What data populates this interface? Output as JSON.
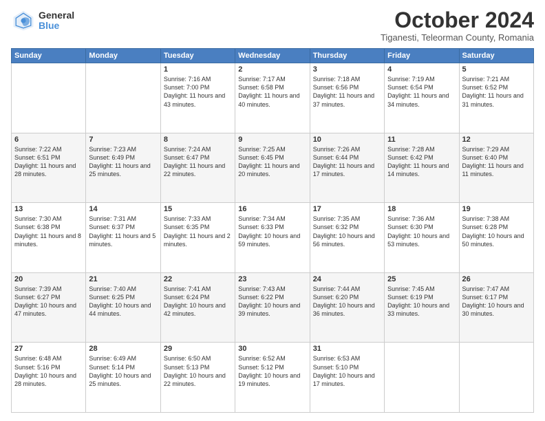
{
  "logo": {
    "general": "General",
    "blue": "Blue"
  },
  "header": {
    "month": "October 2024",
    "location": "Tiganesti, Teleorman County, Romania"
  },
  "weekdays": [
    "Sunday",
    "Monday",
    "Tuesday",
    "Wednesday",
    "Thursday",
    "Friday",
    "Saturday"
  ],
  "weeks": [
    [
      {
        "day": "",
        "text": ""
      },
      {
        "day": "",
        "text": ""
      },
      {
        "day": "1",
        "text": "Sunrise: 7:16 AM\nSunset: 7:00 PM\nDaylight: 11 hours and 43 minutes."
      },
      {
        "day": "2",
        "text": "Sunrise: 7:17 AM\nSunset: 6:58 PM\nDaylight: 11 hours and 40 minutes."
      },
      {
        "day": "3",
        "text": "Sunrise: 7:18 AM\nSunset: 6:56 PM\nDaylight: 11 hours and 37 minutes."
      },
      {
        "day": "4",
        "text": "Sunrise: 7:19 AM\nSunset: 6:54 PM\nDaylight: 11 hours and 34 minutes."
      },
      {
        "day": "5",
        "text": "Sunrise: 7:21 AM\nSunset: 6:52 PM\nDaylight: 11 hours and 31 minutes."
      }
    ],
    [
      {
        "day": "6",
        "text": "Sunrise: 7:22 AM\nSunset: 6:51 PM\nDaylight: 11 hours and 28 minutes."
      },
      {
        "day": "7",
        "text": "Sunrise: 7:23 AM\nSunset: 6:49 PM\nDaylight: 11 hours and 25 minutes."
      },
      {
        "day": "8",
        "text": "Sunrise: 7:24 AM\nSunset: 6:47 PM\nDaylight: 11 hours and 22 minutes."
      },
      {
        "day": "9",
        "text": "Sunrise: 7:25 AM\nSunset: 6:45 PM\nDaylight: 11 hours and 20 minutes."
      },
      {
        "day": "10",
        "text": "Sunrise: 7:26 AM\nSunset: 6:44 PM\nDaylight: 11 hours and 17 minutes."
      },
      {
        "day": "11",
        "text": "Sunrise: 7:28 AM\nSunset: 6:42 PM\nDaylight: 11 hours and 14 minutes."
      },
      {
        "day": "12",
        "text": "Sunrise: 7:29 AM\nSunset: 6:40 PM\nDaylight: 11 hours and 11 minutes."
      }
    ],
    [
      {
        "day": "13",
        "text": "Sunrise: 7:30 AM\nSunset: 6:38 PM\nDaylight: 11 hours and 8 minutes."
      },
      {
        "day": "14",
        "text": "Sunrise: 7:31 AM\nSunset: 6:37 PM\nDaylight: 11 hours and 5 minutes."
      },
      {
        "day": "15",
        "text": "Sunrise: 7:33 AM\nSunset: 6:35 PM\nDaylight: 11 hours and 2 minutes."
      },
      {
        "day": "16",
        "text": "Sunrise: 7:34 AM\nSunset: 6:33 PM\nDaylight: 10 hours and 59 minutes."
      },
      {
        "day": "17",
        "text": "Sunrise: 7:35 AM\nSunset: 6:32 PM\nDaylight: 10 hours and 56 minutes."
      },
      {
        "day": "18",
        "text": "Sunrise: 7:36 AM\nSunset: 6:30 PM\nDaylight: 10 hours and 53 minutes."
      },
      {
        "day": "19",
        "text": "Sunrise: 7:38 AM\nSunset: 6:28 PM\nDaylight: 10 hours and 50 minutes."
      }
    ],
    [
      {
        "day": "20",
        "text": "Sunrise: 7:39 AM\nSunset: 6:27 PM\nDaylight: 10 hours and 47 minutes."
      },
      {
        "day": "21",
        "text": "Sunrise: 7:40 AM\nSunset: 6:25 PM\nDaylight: 10 hours and 44 minutes."
      },
      {
        "day": "22",
        "text": "Sunrise: 7:41 AM\nSunset: 6:24 PM\nDaylight: 10 hours and 42 minutes."
      },
      {
        "day": "23",
        "text": "Sunrise: 7:43 AM\nSunset: 6:22 PM\nDaylight: 10 hours and 39 minutes."
      },
      {
        "day": "24",
        "text": "Sunrise: 7:44 AM\nSunset: 6:20 PM\nDaylight: 10 hours and 36 minutes."
      },
      {
        "day": "25",
        "text": "Sunrise: 7:45 AM\nSunset: 6:19 PM\nDaylight: 10 hours and 33 minutes."
      },
      {
        "day": "26",
        "text": "Sunrise: 7:47 AM\nSunset: 6:17 PM\nDaylight: 10 hours and 30 minutes."
      }
    ],
    [
      {
        "day": "27",
        "text": "Sunrise: 6:48 AM\nSunset: 5:16 PM\nDaylight: 10 hours and 28 minutes."
      },
      {
        "day": "28",
        "text": "Sunrise: 6:49 AM\nSunset: 5:14 PM\nDaylight: 10 hours and 25 minutes."
      },
      {
        "day": "29",
        "text": "Sunrise: 6:50 AM\nSunset: 5:13 PM\nDaylight: 10 hours and 22 minutes."
      },
      {
        "day": "30",
        "text": "Sunrise: 6:52 AM\nSunset: 5:12 PM\nDaylight: 10 hours and 19 minutes."
      },
      {
        "day": "31",
        "text": "Sunrise: 6:53 AM\nSunset: 5:10 PM\nDaylight: 10 hours and 17 minutes."
      },
      {
        "day": "",
        "text": ""
      },
      {
        "day": "",
        "text": ""
      }
    ]
  ]
}
